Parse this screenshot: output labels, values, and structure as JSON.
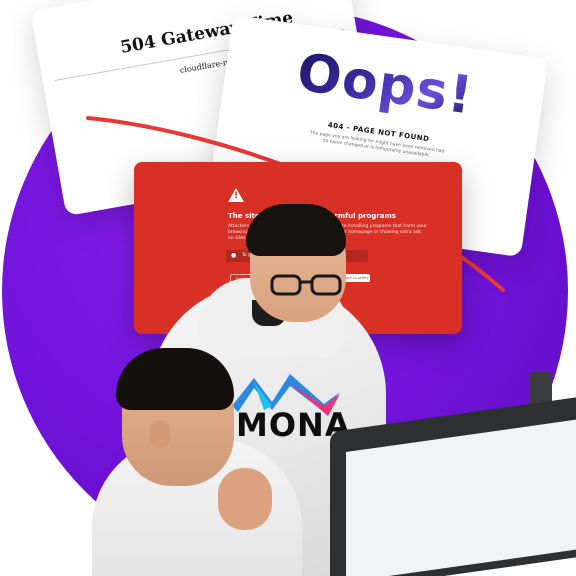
{
  "card_504": {
    "title": "504 Gateway Time",
    "subtitle": "cloudflare-nginx"
  },
  "card_oops": {
    "headline": "Oops!",
    "code": "404 - PAGE NOT FOUND",
    "description": "The page you are looking for might have been removed had its name changed or is temporarily unavailable."
  },
  "card_warning": {
    "title": "The site ahead contains harmful programs",
    "body": "Attackers on this site might attempt to trick you into installing programs that harm your browsing experience (for example, by changing your homepage or showing extra ads on sites you visit).",
    "url_hint": "To get the latest protection",
    "details_label": "Details",
    "back_label": "Back to safety"
  },
  "logo": {
    "text": "MONA"
  },
  "colors": {
    "circle": "#6f12d8",
    "warning": "#d93025",
    "swoosh": "#e53935"
  },
  "icons": [
    "warning-icon",
    "pin-icon"
  ]
}
